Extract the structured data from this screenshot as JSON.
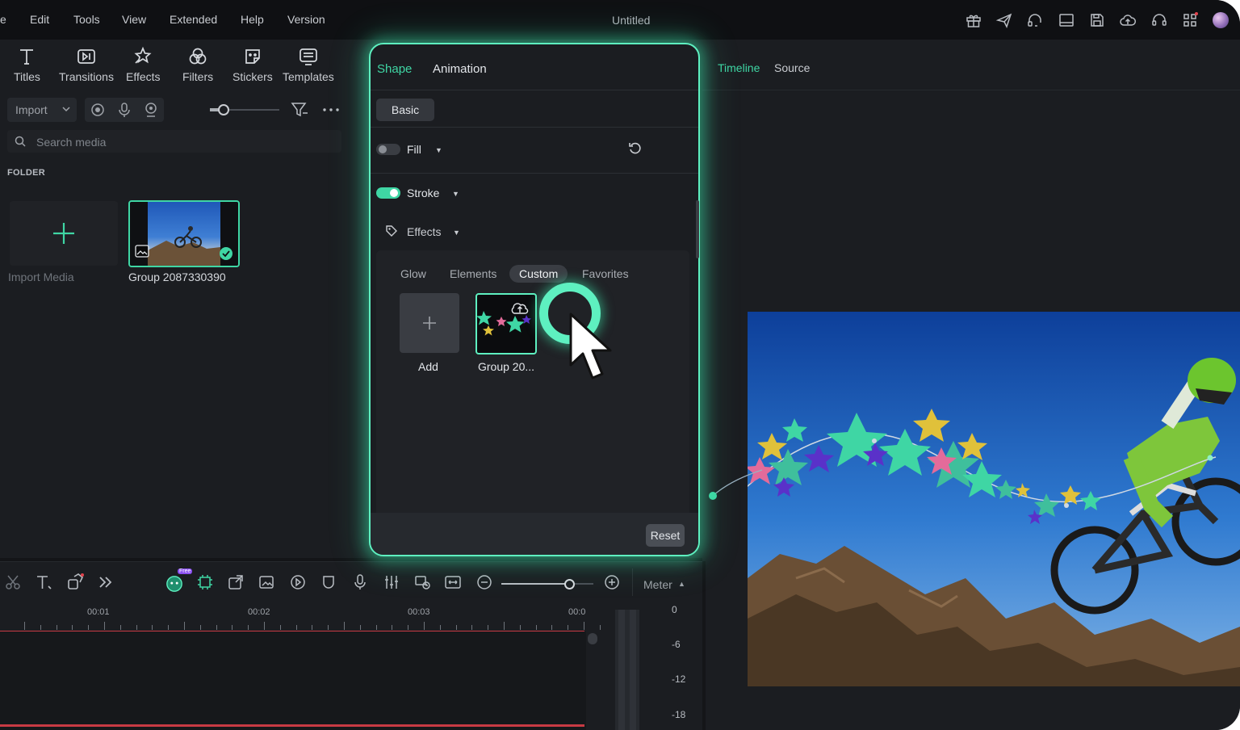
{
  "menubar": {
    "items": [
      "e",
      "Edit",
      "Tools",
      "View",
      "Extended",
      "Help",
      "Version"
    ],
    "title": "Untitled",
    "icons": [
      "gift-icon",
      "send-icon",
      "headset-icon",
      "layout-icon",
      "save-icon",
      "cloud-upload-icon",
      "support-icon",
      "apps-icon",
      "avatar"
    ]
  },
  "toolbar": {
    "items": [
      {
        "label": "Titles",
        "icon": "titles-icon"
      },
      {
        "label": "Transitions",
        "icon": "transitions-icon"
      },
      {
        "label": "Effects",
        "icon": "effects-icon"
      },
      {
        "label": "Filters",
        "icon": "filters-icon"
      },
      {
        "label": "Stickers",
        "icon": "stickers-icon"
      },
      {
        "label": "Templates",
        "icon": "templates-icon"
      }
    ]
  },
  "media": {
    "import_label": "Import",
    "search_placeholder": "Search media",
    "folder_label": "FOLDER",
    "import_media_label": "Import Media",
    "clip_label": "Group 2087330390"
  },
  "shape_panel": {
    "tabs": [
      "Shape",
      "Animation"
    ],
    "active_tab": "Shape",
    "basic_label": "Basic",
    "fill_label": "Fill",
    "stroke_label": "Stroke",
    "effects_label": "Effects",
    "effect_tabs": [
      "Glow",
      "Elements",
      "Custom",
      "Favorites"
    ],
    "active_effect_tab": "Custom",
    "add_label": "Add",
    "group_label": "Group 20...",
    "reset_label": "Reset",
    "fill_enabled": false,
    "stroke_enabled": true
  },
  "preview": {
    "tabs": [
      "Timeline",
      "Source"
    ],
    "active_tab": "Timeline"
  },
  "timeline": {
    "ticks": [
      "00:01",
      "00:02",
      "00:03",
      "00:0"
    ],
    "meter_label": "Meter",
    "meter_scale": [
      "0",
      "-6",
      "-12",
      "-18"
    ],
    "ai_badge": "Free"
  },
  "colors": {
    "accent": "#5ef0c0",
    "background": "#1b1d21",
    "menubar": "#0f1013"
  }
}
